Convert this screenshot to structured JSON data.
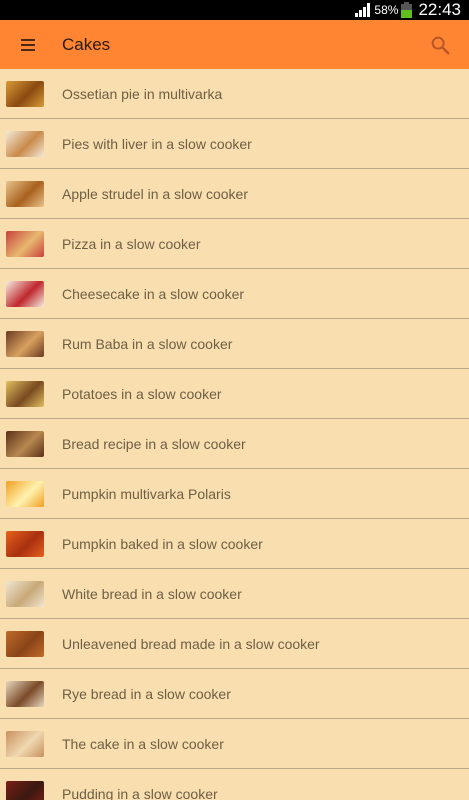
{
  "status": {
    "battery": "58%",
    "time": "22:43"
  },
  "appbar": {
    "title": "Cakes"
  },
  "colors": {
    "appbar": "#ff8533",
    "background": "#f9dfb0",
    "text": "#6e5e44"
  },
  "items": [
    {
      "label": "Ossetian pie in multivarka",
      "thumb": [
        "#d99a3a",
        "#8a4a10"
      ]
    },
    {
      "label": "Pies with liver in a slow cooker",
      "thumb": [
        "#f3ead8",
        "#c98a4a"
      ]
    },
    {
      "label": "Apple strudel in a slow cooker",
      "thumb": [
        "#e8c48a",
        "#a8601e"
      ]
    },
    {
      "label": "Pizza in a slow cooker",
      "thumb": [
        "#c8403a",
        "#e8b870"
      ]
    },
    {
      "label": "Cheesecake in a slow cooker",
      "thumb": [
        "#f5efe0",
        "#c0262e"
      ]
    },
    {
      "label": "Rum Baba in a slow cooker",
      "thumb": [
        "#6a3a20",
        "#d8a060"
      ]
    },
    {
      "label": "Potatoes in a slow cooker",
      "thumb": [
        "#e0c060",
        "#7a4a20"
      ]
    },
    {
      "label": "Bread recipe in a slow cooker",
      "thumb": [
        "#5a3018",
        "#b88850"
      ]
    },
    {
      "label": "Pumpkin multivarka Polaris",
      "thumb": [
        "#f0a020",
        "#fff2b0"
      ]
    },
    {
      "label": "Pumpkin baked in a slow cooker",
      "thumb": [
        "#e8621e",
        "#a83010"
      ]
    },
    {
      "label": "White bread in a slow cooker",
      "thumb": [
        "#f0e6d0",
        "#c8a878"
      ]
    },
    {
      "label": "Unleavened bread made in a slow cooker",
      "thumb": [
        "#c06a2a",
        "#8a4418"
      ]
    },
    {
      "label": "Rye bread in a slow cooker",
      "thumb": [
        "#e8d8c0",
        "#7a4a28"
      ]
    },
    {
      "label": "The cake in a slow cooker",
      "thumb": [
        "#c89060",
        "#f0d8b0"
      ]
    },
    {
      "label": "Pudding in a slow cooker",
      "thumb": [
        "#7a2018",
        "#3a1810"
      ]
    }
  ]
}
